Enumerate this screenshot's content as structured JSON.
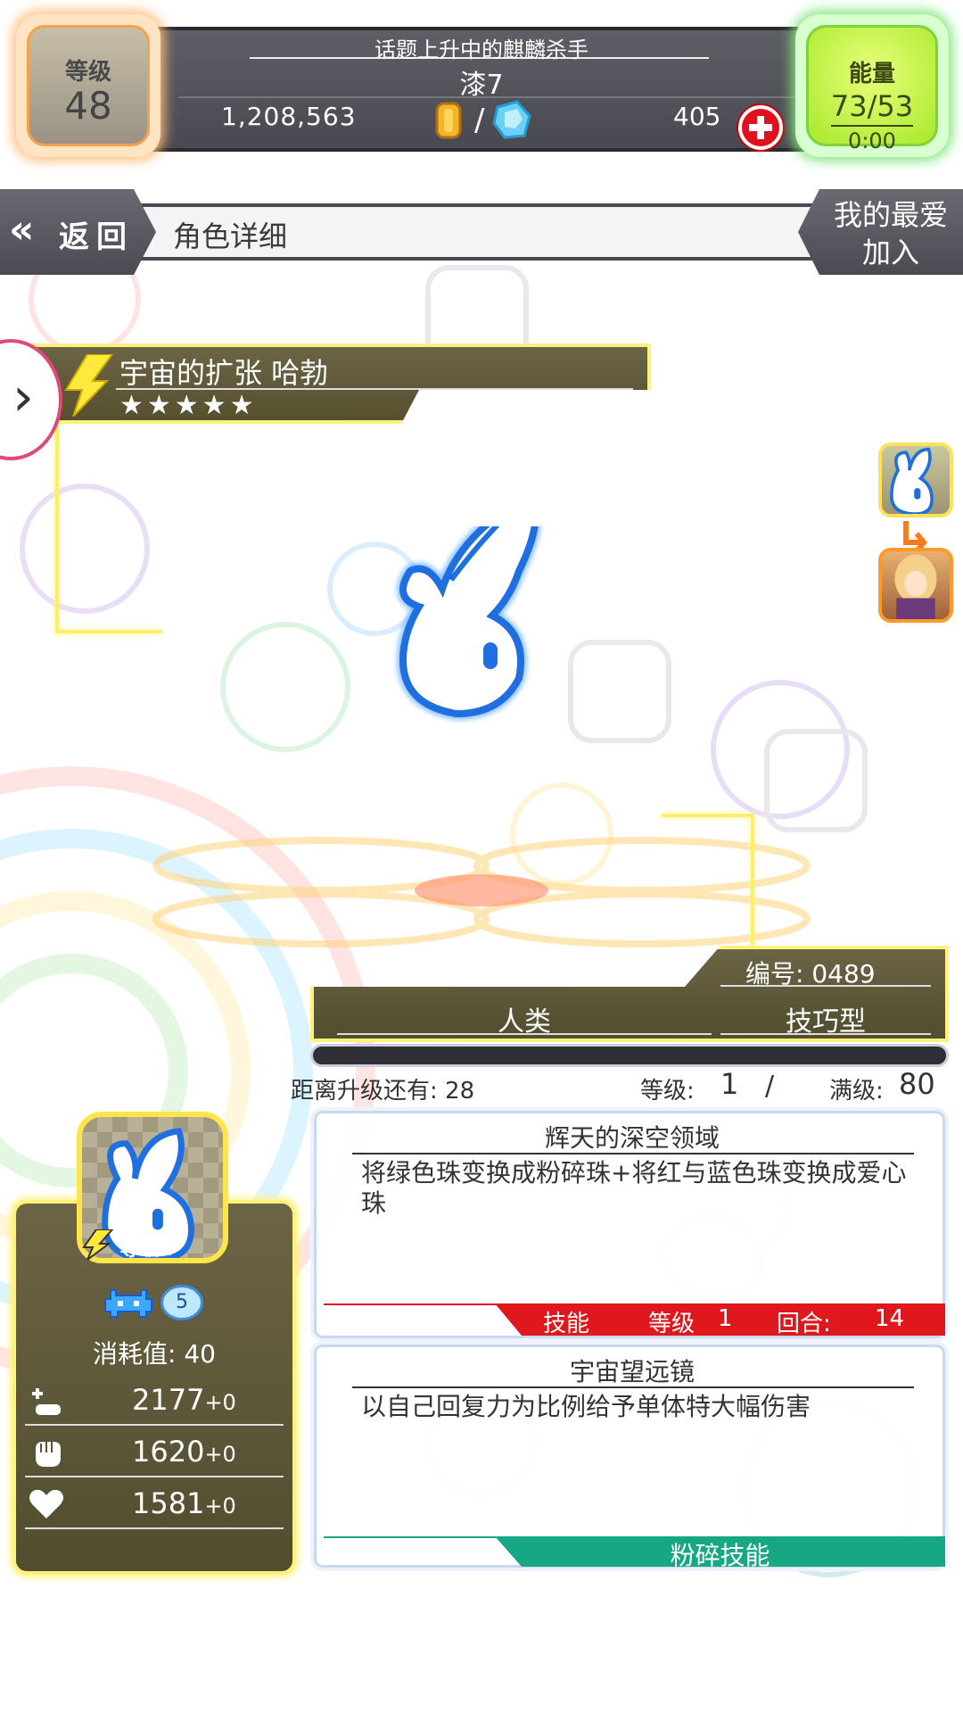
{
  "status": {
    "level_label": "等级",
    "level_value": "48",
    "title": "话题上升中的麒麟杀手",
    "player_name": "漆7",
    "coins": "1,208,563",
    "currency_separator": "/",
    "gems": "405",
    "energy_label": "能量",
    "energy_value": "73/53",
    "energy_timer": "0:00"
  },
  "nav": {
    "back_label": "返回",
    "page_title": "角色详细",
    "favorite_line1": "我的最爱",
    "favorite_line2": "加入"
  },
  "character": {
    "name": "宇宙的扩张 哈勃",
    "stars": "★★★★★",
    "attribute_icon": "lightning-icon",
    "number": "编号: 0489",
    "race": "人类",
    "type": "技巧型"
  },
  "progress": {
    "exp_remaining_text": "距离升级还有: 28",
    "level_label": "等级:",
    "level_value": "1",
    "level_separator": "/",
    "max_label": "满级:",
    "max_value": "80",
    "exp_fill_fraction": 0
  },
  "skills": [
    {
      "name": "辉天的深空领域",
      "description": "将绿色珠变换成粉碎珠+将红与蓝色珠变换成爱心珠",
      "type_label": "技能",
      "level_label": "等级",
      "level_value": "1",
      "turns_label": "回合:",
      "turns_value": "14"
    },
    {
      "name": "宇宙望远镜",
      "description": "以自己回复力为比例给予单体特大幅伤害",
      "type_label": "粉碎技能"
    }
  ],
  "stats": {
    "avatar_level": "等级1",
    "type_badge": "5",
    "cost_text": "消耗值: 40",
    "hp": "2177",
    "hp_bonus": "+0",
    "attack": "1620",
    "attack_bonus": "+0",
    "recovery": "1581",
    "recovery_bonus": "+0"
  },
  "colors": {
    "panel_brown": "#5e5839",
    "glow_yellow": "#fff27a",
    "skill_red": "#e0181e",
    "smash_green": "#17a783",
    "energy_green": "#a7e82a",
    "rabbit_blue": "#1f6fe0"
  }
}
